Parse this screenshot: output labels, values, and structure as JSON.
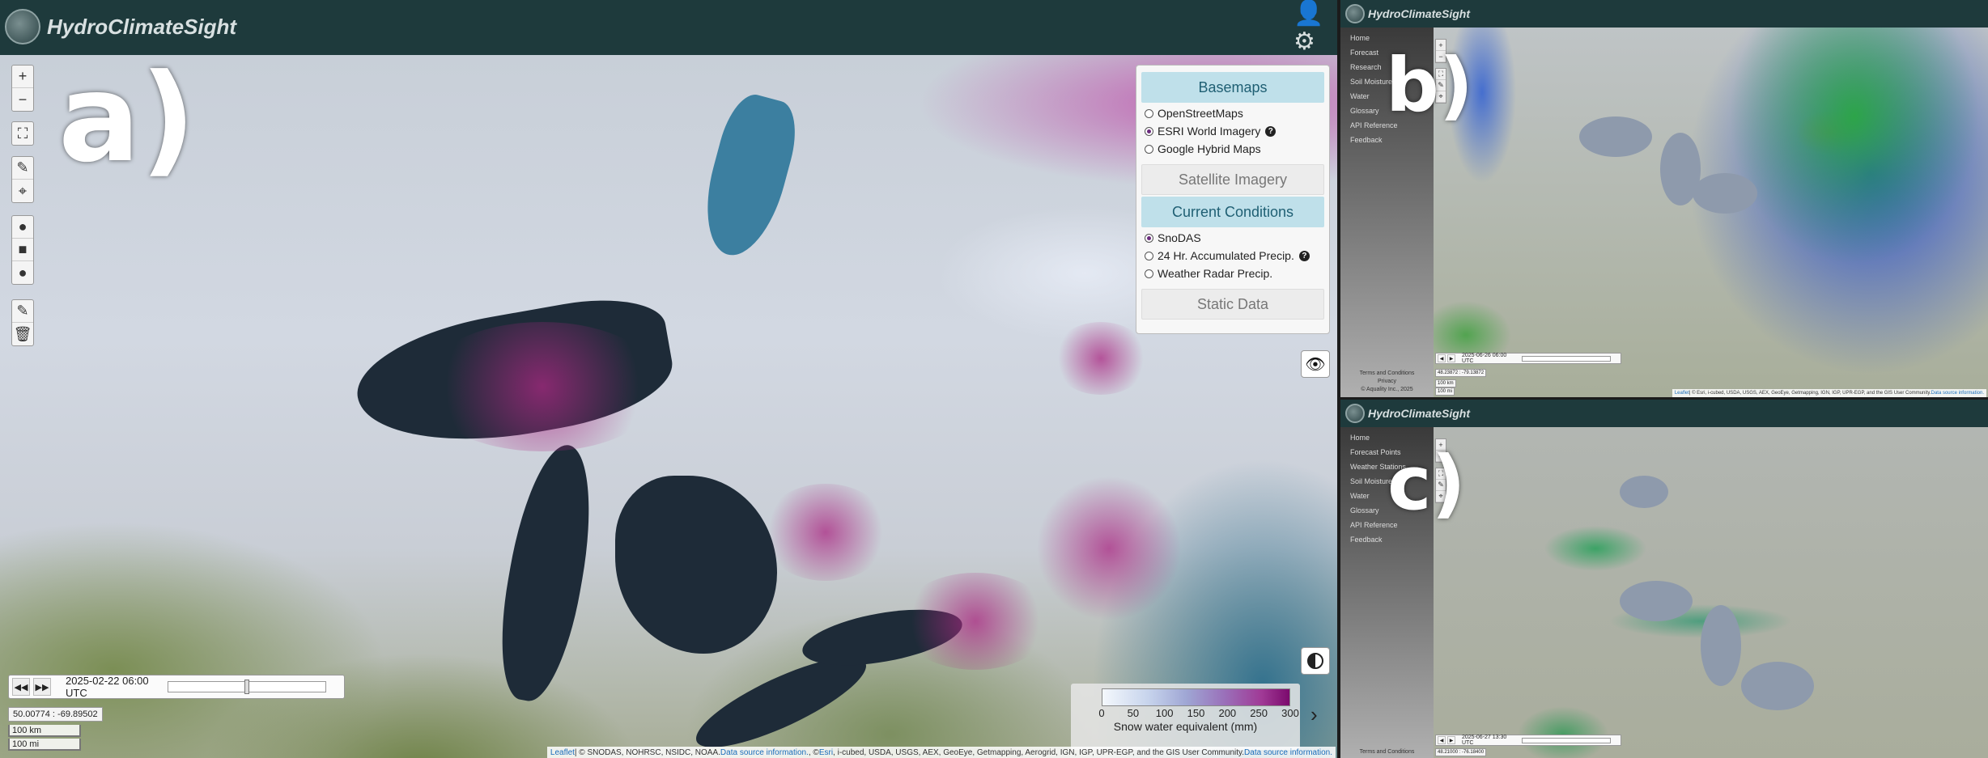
{
  "panel_a": {
    "app_title": "HydroClimateSight",
    "label": "a)",
    "layer_panel": {
      "basemaps_header": "Basemaps",
      "basemaps": [
        {
          "label": "OpenStreetMaps",
          "selected": false
        },
        {
          "label": "ESRI World Imagery",
          "selected": true
        },
        {
          "label": "Google Hybrid Maps",
          "selected": false
        }
      ],
      "satellite_header": "Satellite Imagery",
      "current_header": "Current Conditions",
      "current": [
        {
          "label": "SnoDAS",
          "selected": true
        },
        {
          "label": "24 Hr. Accumulated Precip.",
          "selected": false
        },
        {
          "label": "Weather Radar Precip.",
          "selected": false
        }
      ],
      "static_header": "Static Data"
    },
    "time": {
      "current": "2025-02-22 06:00 UTC",
      "slider_position": 0.5
    },
    "coordinates": "50.00774 : -69.89502",
    "scale": {
      "km": "100 km",
      "mi": "100 mi"
    },
    "legend": {
      "ticks": [
        "0",
        "50",
        "100",
        "150",
        "200",
        "250",
        "300"
      ],
      "title": "Snow water equivalent (mm)"
    },
    "attribution": {
      "leaflet": "Leaflet",
      "text1": " | © SNODAS, NOHRSC, NSIDC, NOAA. ",
      "link1": "Data source information.",
      "text2": ", © ",
      "esri": "Esri",
      "text3": ", i-cubed, USDA, USGS, AEX, GeoEye, Getmapping, Aerogrid, IGN, IGP, UPR-EGP, and the GIS User Community. ",
      "link2": "Data source information."
    }
  },
  "panel_b": {
    "app_title": "HydroClimateSight",
    "label": "b)",
    "sidebar_items": [
      "Home",
      "Forecast",
      "Research",
      "Soil Moisture",
      "Water",
      "Glossary",
      "API Reference",
      "Feedback"
    ],
    "footer": [
      "Terms and Conditions",
      "Privacy",
      "© Aquality Inc., 2025"
    ],
    "time": "2025-06-26 06:00 UTC",
    "coordinates": "48.23872 : -79.13872",
    "scale": {
      "km": "100 km",
      "mi": "100 mi"
    },
    "attribution": {
      "leaflet": "Leaflet",
      "text": " | © Esri, i-cubed, USDA, USGS, AEX, GeoEye, Getmapping, IGN, IGP, UPR-EGP, and the GIS User Community. ",
      "link": "Data source information."
    }
  },
  "panel_c": {
    "app_title": "HydroClimateSight",
    "label": "c)",
    "sidebar_items": [
      "Home",
      "Forecast Points",
      "Weather Stations",
      "Soil Moisture",
      "Water",
      "Glossary",
      "API Reference",
      "Feedback"
    ],
    "footer": [
      "Terms and Conditions"
    ],
    "time": "2025-06-27 13:30 UTC",
    "coordinates": "48.21000 : -76.18400"
  },
  "colors": {
    "topbar": "#1e3a3c",
    "active_header": "#bfe0ea",
    "accent_radio": "#6a2a7d",
    "link": "#1a6dbb"
  },
  "icons": {
    "zoom_in": "plus-icon",
    "zoom_out": "minus-icon",
    "fullscreen": "fullscreen-icon",
    "draw": "pencil-icon",
    "crop": "crop-icon",
    "hide_panel": "eye-slash-icon",
    "contrast": "contrast-icon",
    "user_settings": "user-gear-icon",
    "legend_toggle": "chevron-right-icon"
  }
}
